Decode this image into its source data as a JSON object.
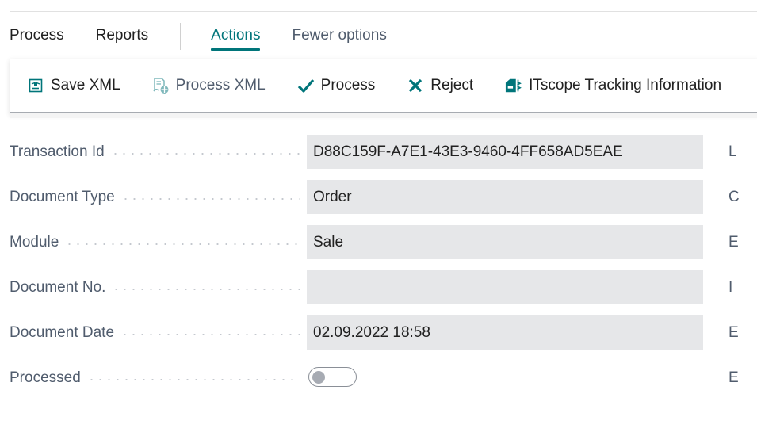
{
  "tabs": [
    {
      "label": "Process",
      "state": "normal"
    },
    {
      "label": "Reports",
      "state": "normal"
    },
    {
      "label": "Actions",
      "state": "active"
    },
    {
      "label": "Fewer options",
      "state": "muted"
    }
  ],
  "actions": [
    {
      "label": "Save XML",
      "icon": "save-xml-icon",
      "enabled": true
    },
    {
      "label": "Process XML",
      "icon": "process-xml-icon",
      "enabled": false
    },
    {
      "label": "Process",
      "icon": "checkmark-icon",
      "enabled": true
    },
    {
      "label": "Reject",
      "icon": "x-icon",
      "enabled": true
    },
    {
      "label": "ITscope Tracking Information",
      "icon": "tracking-icon",
      "enabled": true
    }
  ],
  "fields": [
    {
      "label": "Transaction Id",
      "value": "D88C159F-A7E1-43E3-9460-4FF658AD5EAE"
    },
    {
      "label": "Document Type",
      "value": "Order"
    },
    {
      "label": "Module",
      "value": "Sale"
    },
    {
      "label": "Document No.",
      "value": ""
    },
    {
      "label": "Document Date",
      "value": "02.09.2022 18:58"
    },
    {
      "label": "Processed",
      "value": false
    }
  ],
  "right_column_labels_truncated": [
    "L",
    "C",
    "E",
    "I",
    "E",
    "E"
  ],
  "colors": {
    "accent": "#00757a",
    "field_bg": "#e6e7e9",
    "label": "#505c6d"
  }
}
